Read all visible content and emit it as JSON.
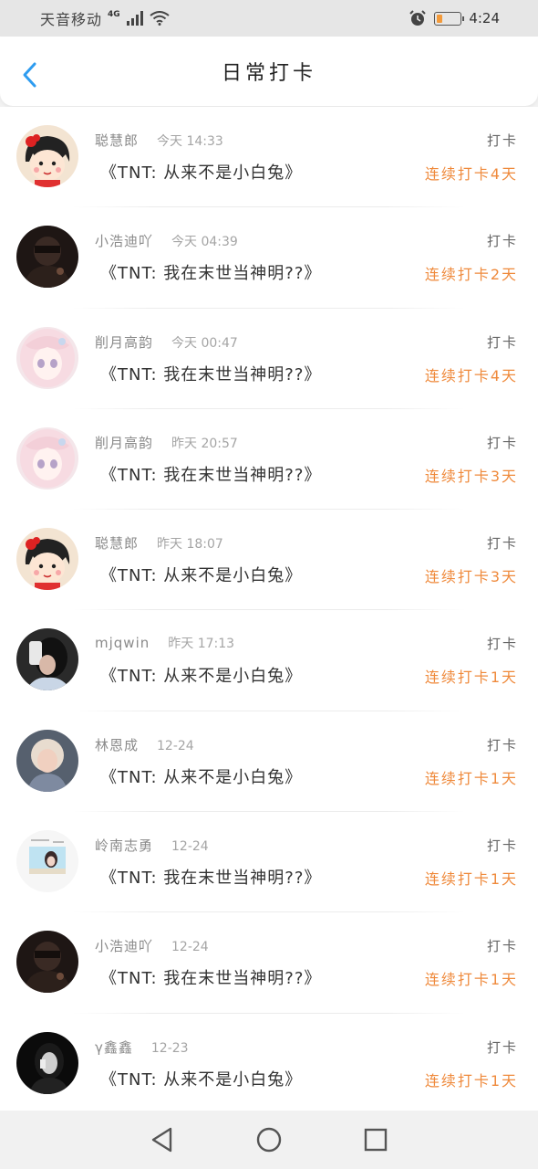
{
  "status_bar": {
    "carrier": "天音移动",
    "network": "4G",
    "time": "4:24",
    "battery_level": 0.25
  },
  "header": {
    "title": "日常打卡",
    "back_icon": "chevron-left-icon"
  },
  "colors": {
    "accent_back": "#2e9cf0",
    "streak": "#ef8a3c",
    "battery": "#f39a3a"
  },
  "entries": [
    {
      "avatar": "maruko",
      "username": "聪慧郎",
      "time": "今天 14:33",
      "book": "《TNT: 从来不是小白兔》",
      "label": "打卡",
      "streak": "连续打卡4天"
    },
    {
      "avatar": "dark-person",
      "username": "小浩迪吖",
      "time": "今天 04:39",
      "book": "《TNT: 我在末世当神明??》",
      "label": "打卡",
      "streak": "连续打卡2天"
    },
    {
      "avatar": "anime-girl",
      "username": "削月高韵",
      "time": "今天 00:47",
      "book": "《TNT: 我在末世当神明??》",
      "label": "打卡",
      "streak": "连续打卡4天"
    },
    {
      "avatar": "anime-girl",
      "username": "削月高韵",
      "time": "昨天 20:57",
      "book": "《TNT: 我在末世当神明??》",
      "label": "打卡",
      "streak": "连续打卡3天"
    },
    {
      "avatar": "maruko",
      "username": "聪慧郎",
      "time": "昨天 18:07",
      "book": "《TNT: 从来不是小白兔》",
      "label": "打卡",
      "streak": "连续打卡3天"
    },
    {
      "avatar": "phone-selfie",
      "username": "mjqwin",
      "time": "昨天 17:13",
      "book": "《TNT: 从来不是小白兔》",
      "label": "打卡",
      "streak": "连续打卡1天"
    },
    {
      "avatar": "blonde-person",
      "username": "林恩成",
      "time": "12-24",
      "book": "《TNT: 从来不是小白兔》",
      "label": "打卡",
      "streak": "连续打卡1天"
    },
    {
      "avatar": "beach-girl",
      "username": "岭南志勇",
      "time": "12-24",
      "book": "《TNT: 我在末世当神明??》",
      "label": "打卡",
      "streak": "连续打卡1天"
    },
    {
      "avatar": "dark-person",
      "username": "小浩迪吖",
      "time": "12-24",
      "book": "《TNT: 我在末世当神明??》",
      "label": "打卡",
      "streak": "连续打卡1天"
    },
    {
      "avatar": "dark-girl",
      "username": "γ鑫鑫",
      "time": "12-23",
      "book": "《TNT: 从来不是小白兔》",
      "label": "打卡",
      "streak": "连续打卡1天"
    }
  ],
  "nav": {
    "back_icon": "triangle-back-icon",
    "home_icon": "circle-home-icon",
    "recent_icon": "square-recents-icon"
  }
}
